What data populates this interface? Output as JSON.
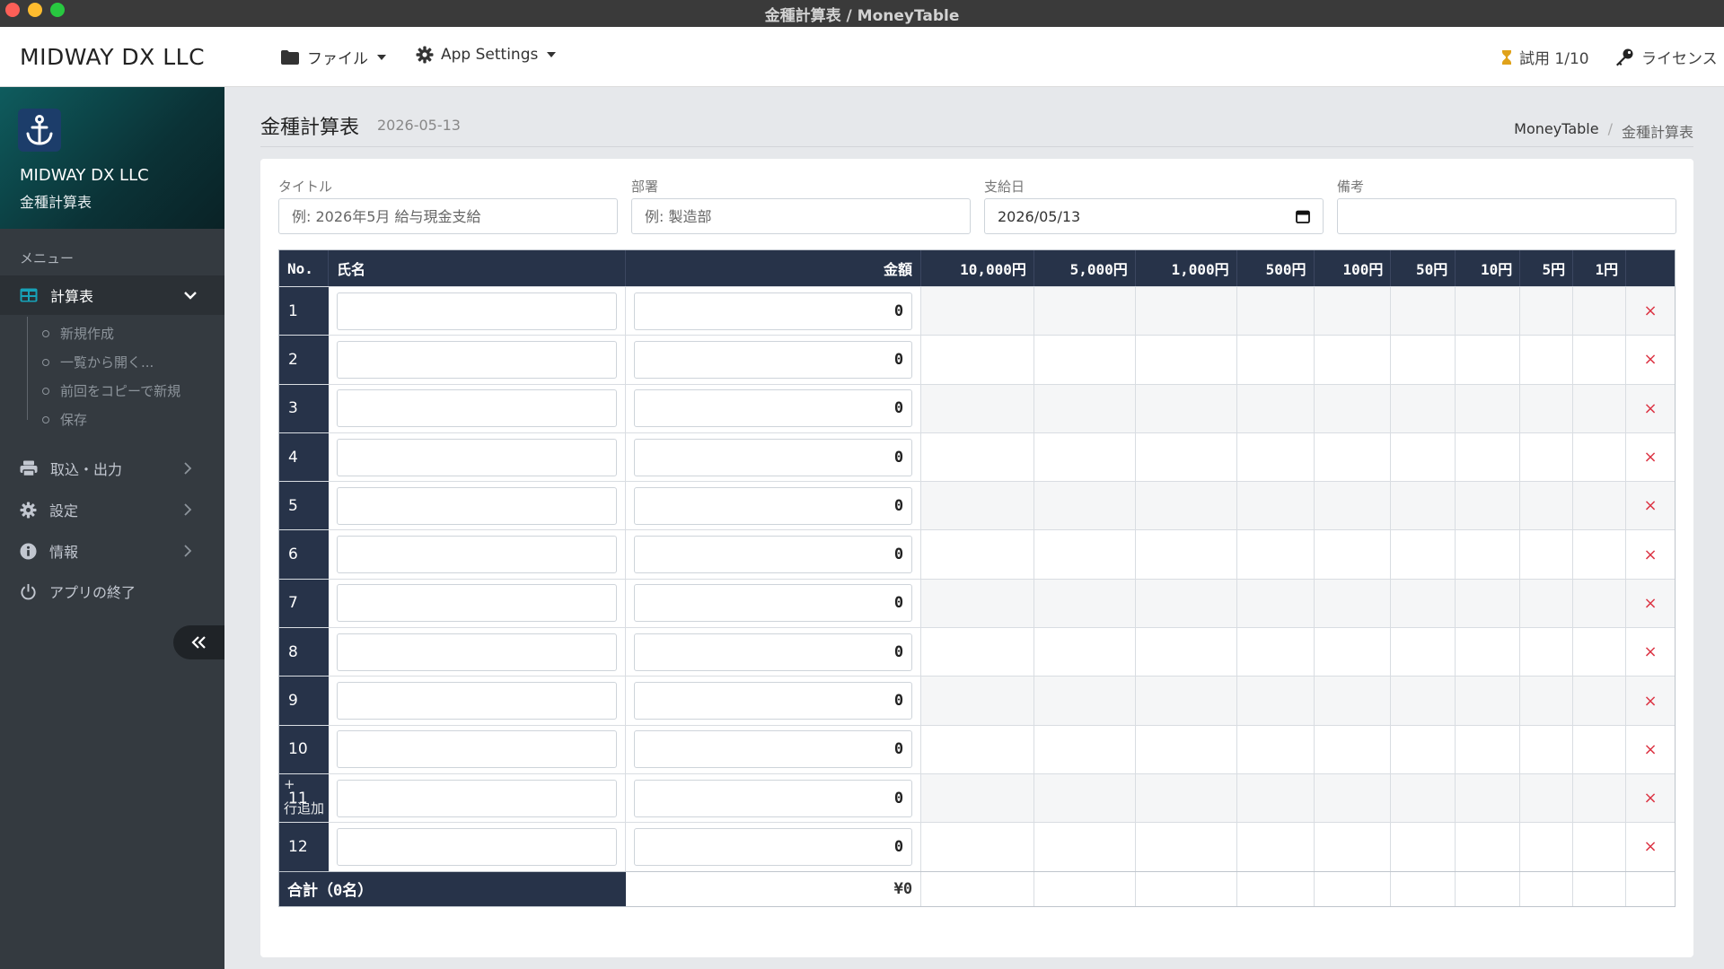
{
  "window": {
    "title": "金種計算表 / MoneyTable"
  },
  "header": {
    "brand": "MIDWAY DX LLC",
    "file_menu": "ファイル",
    "settings_menu": "App Settings",
    "trial": "試用 1/10",
    "license": "ライセンス"
  },
  "sidebar": {
    "company": "MIDWAY DX LLC",
    "app_name": "金種計算表",
    "section": "メニュー",
    "active": "計算表",
    "subitems": [
      "新規作成",
      "一覧から開く...",
      "前回をコピーで新規",
      "保存"
    ],
    "items": [
      "取込・出力",
      "設定",
      "情報",
      "アプリの終了"
    ]
  },
  "page": {
    "title": "金種計算表",
    "date": "2026-05-13",
    "breadcrumb": [
      "MoneyTable",
      "金種計算表"
    ]
  },
  "form": {
    "title_label": "タイトル",
    "title_placeholder": "例: 2026年5月 給与現金支給",
    "dept_label": "部署",
    "dept_placeholder": "例: 製造部",
    "date_label": "支給日",
    "date_value": "2026/05/13",
    "note_label": "備考"
  },
  "table": {
    "headers": {
      "no": "No.",
      "name": "氏名",
      "amount": "金額",
      "denoms": [
        "10,000円",
        "5,000円",
        "1,000円",
        "500円",
        "100円",
        "50円",
        "10円",
        "5円",
        "1円"
      ]
    },
    "rows": [
      {
        "no": "1",
        "amount": "0"
      },
      {
        "no": "2",
        "amount": "0"
      },
      {
        "no": "3",
        "amount": "0"
      },
      {
        "no": "4",
        "amount": "0"
      },
      {
        "no": "5",
        "amount": "0"
      },
      {
        "no": "6",
        "amount": "0"
      },
      {
        "no": "7",
        "amount": "0"
      },
      {
        "no": "8",
        "amount": "0"
      },
      {
        "no": "9",
        "amount": "0"
      },
      {
        "no": "10",
        "amount": "0"
      },
      {
        "no": "11",
        "amount": "0"
      },
      {
        "no": "12",
        "amount": "0"
      }
    ],
    "delete_glyph": "×",
    "total_label": "合計（0名）",
    "total_value": "¥0"
  },
  "footer_hint": {
    "plus": "+",
    "text": "行追加"
  },
  "colors": {
    "header_bg": "#273349",
    "sidebar_bg": "#343a40",
    "delete": "#dc3545",
    "trial_icon": "#e0a21a"
  }
}
